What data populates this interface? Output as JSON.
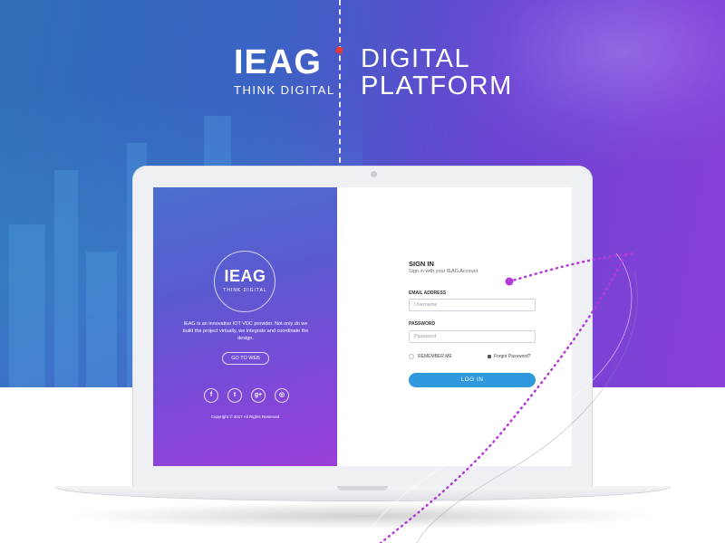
{
  "hero": {
    "logo_text": "IEAG",
    "logo_tagline": "THINK DIGITAL",
    "headline_line1": "DIGITAL",
    "headline_line2": "PLATFORM"
  },
  "left_panel": {
    "logo_text": "IEAG",
    "logo_tagline": "THINK DIGITAL",
    "description": "IEAG is an innovative IOT VDC provider. Not only do we build the project virtually, we integrate and coordinate the design.",
    "go_button": "GO TO WEB",
    "socials": [
      {
        "icon": "facebook-icon",
        "glyph": "f"
      },
      {
        "icon": "twitter-icon",
        "glyph": "t"
      },
      {
        "icon": "google-plus-icon",
        "glyph": "g+"
      },
      {
        "icon": "instagram-icon",
        "glyph": "◎"
      }
    ],
    "copyright": "Copyright © 2017 All Rights Reserved"
  },
  "login": {
    "title": "SIGN IN",
    "subtitle": "Sign in with your IEAG Account",
    "email_label": "EMAIL ADDRESS",
    "email_placeholder": "Username",
    "password_label": "PASSWORD",
    "password_placeholder": "Password",
    "remember_label": "REMEMBER ME",
    "forgot_label": "Forgot Password?",
    "login_button": "LOG IN"
  },
  "colors": {
    "accent_blue": "#2f98de",
    "gradient_purple": "#8a3fd8",
    "dotted_line": "#b43ad6"
  }
}
